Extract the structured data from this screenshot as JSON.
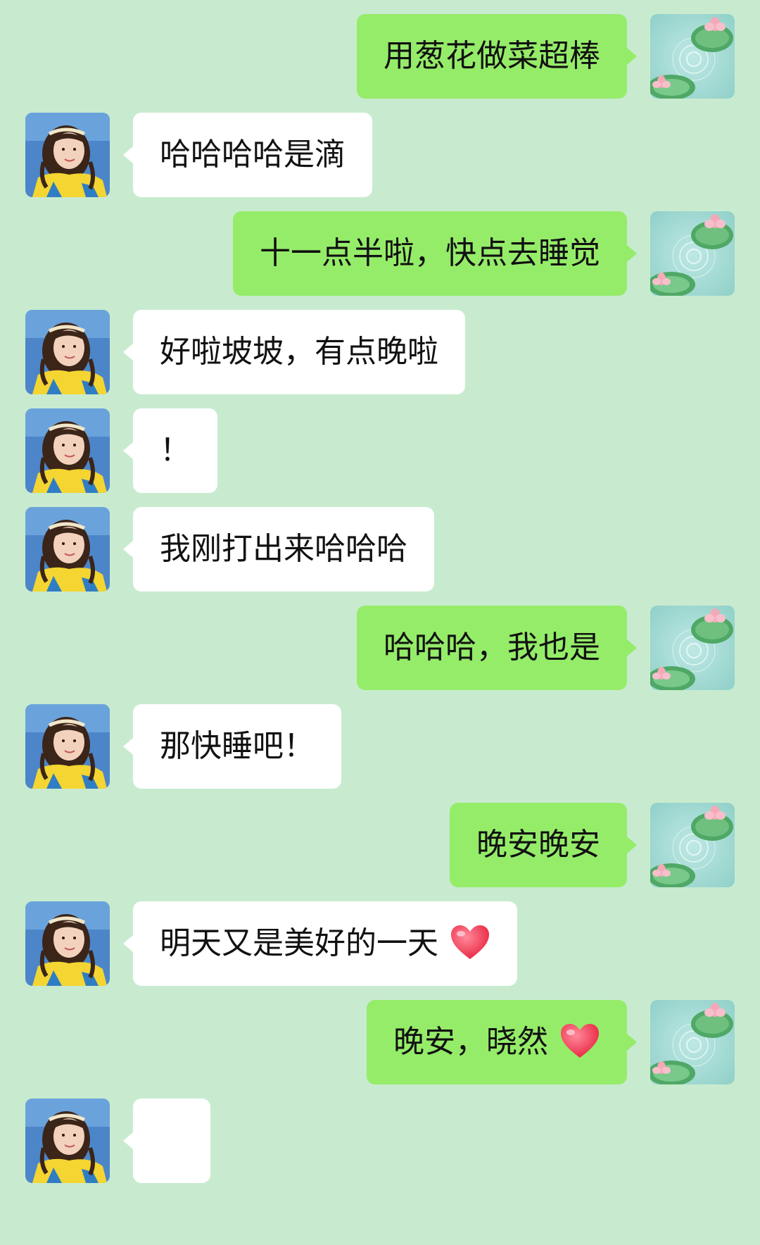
{
  "colors": {
    "background": "#c8ebcf",
    "sent_bubble": "#95ec69",
    "received_bubble": "#ffffff",
    "heart": "#ff3b5c"
  },
  "avatars": {
    "self": "lotus-pond-avatar",
    "contact": "girl-yellow-shirt-avatar"
  },
  "messages": [
    {
      "side": "right",
      "text": "用葱花做菜超棒"
    },
    {
      "side": "left",
      "text": "哈哈哈哈是滴"
    },
    {
      "side": "right",
      "text": "十一点半啦，快点去睡觉"
    },
    {
      "side": "left",
      "text": "好啦坡坡，有点晚啦"
    },
    {
      "side": "left",
      "text": "！"
    },
    {
      "side": "left",
      "text": "我刚打出来哈哈哈"
    },
    {
      "side": "right",
      "text": "哈哈哈，我也是"
    },
    {
      "side": "left",
      "text": "那快睡吧！"
    },
    {
      "side": "right",
      "text": "晚安晚安"
    },
    {
      "side": "left",
      "text": "明天又是美好的一天",
      "emoji": "heart-emoji"
    },
    {
      "side": "right",
      "text": "晚安，晓然",
      "emoji": "heart-emoji"
    },
    {
      "side": "left",
      "text": ""
    }
  ]
}
